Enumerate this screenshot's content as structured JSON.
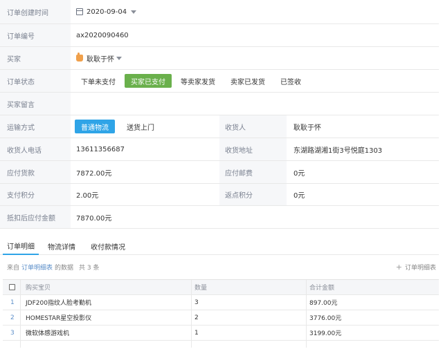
{
  "order": {
    "created_label": "订单创建时间",
    "created_value": "2020-09-04",
    "number_label": "订单编号",
    "number_value": "ax2020090460",
    "buyer_label": "买家",
    "buyer_value": "耿耿于怀",
    "status_label": "订单状态",
    "statuses": [
      "下单未支付",
      "买家已支付",
      "等卖家发货",
      "卖家已发货",
      "已签收"
    ],
    "active_status": "买家已支付",
    "message_label": "买家留言",
    "message_value": "",
    "shipping_label": "运输方式",
    "shipping_options": [
      "普通物流",
      "送货上门"
    ],
    "active_shipping": "普通物流",
    "receiver_label": "收货人",
    "receiver_value": "耿耿于怀",
    "phone_label": "收货人电话",
    "phone_value": "13611356687",
    "address_label": "收货地址",
    "address_value": "东湖路湖湘1街3号悦庭1303",
    "goods_label": "应付货款",
    "goods_value": "7872.00元",
    "postage_label": "应付邮费",
    "postage_value": "0元",
    "points_label": "支付积分",
    "points_value": "2.00元",
    "rebate_label": "返点积分",
    "rebate_value": "0元",
    "final_label": "抵扣后应付金额",
    "final_value": "7870.00元"
  },
  "tabs": [
    "订单明细",
    "物流详情",
    "收付款情况"
  ],
  "active_tab": "订单明细",
  "detail": {
    "source_prefix": "来自",
    "source_link": "订单明细表",
    "source_suffix": "的数据",
    "count_text": "共 3 条",
    "add_label": "订单明细表"
  },
  "table": {
    "columns": [
      "购买宝贝",
      "数量",
      "合计金额"
    ],
    "rows": [
      {
        "index": "1",
        "name": "JDF200指纹人脸考勤机",
        "qty": "3",
        "total": "897.00元"
      },
      {
        "index": "2",
        "name": "HOMESTAR星空投影仪",
        "qty": "2",
        "total": "3776.00元"
      },
      {
        "index": "3",
        "name": "微软体感游戏机",
        "qty": "1",
        "total": "3199.00元"
      }
    ]
  },
  "colors": {
    "active_status_bg": "#6ab04c",
    "active_shipping_bg": "#2fa4e7",
    "label_bg": "#f6f7f9",
    "link": "#5b8ec9"
  }
}
